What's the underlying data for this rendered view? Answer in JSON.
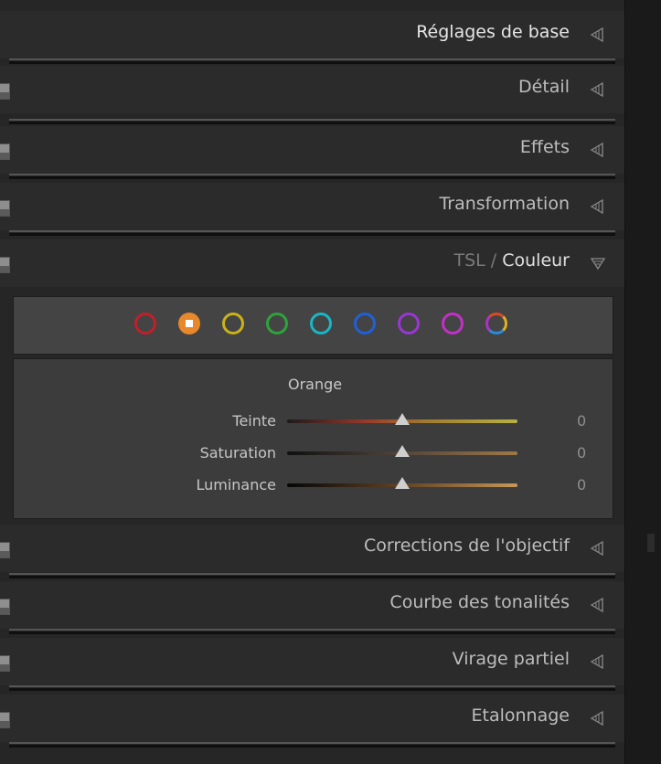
{
  "sections": {
    "basic": "Réglages de base",
    "detail": "Détail",
    "effects": "Effets",
    "transform": "Transformation",
    "hsl_prefix": "TSL",
    "hsl_slash": "/",
    "hsl_active": "Couleur",
    "lens": "Corrections de l'objectif",
    "tone_curve": "Courbe des tonalités",
    "split_toning": "Virage partiel",
    "calibration": "Etalonnage"
  },
  "color_swatches": [
    {
      "name": "red",
      "color": "#c0202a"
    },
    {
      "name": "orange",
      "color": "#e8882a",
      "selected": true
    },
    {
      "name": "yellow",
      "color": "#c9b21a"
    },
    {
      "name": "green",
      "color": "#2ea33a"
    },
    {
      "name": "aqua",
      "color": "#18b7c6"
    },
    {
      "name": "blue",
      "color": "#2060d8"
    },
    {
      "name": "purple",
      "color": "#9a35d8"
    },
    {
      "name": "magenta",
      "color": "#c330c8"
    },
    {
      "name": "all",
      "color": "multicolor"
    }
  ],
  "selected_color": "Orange",
  "sliders": {
    "hue": {
      "label": "Teinte",
      "value": "0",
      "position": 0.5
    },
    "saturation": {
      "label": "Saturation",
      "value": "0",
      "position": 0.5
    },
    "luminance": {
      "label": "Luminance",
      "value": "0",
      "position": 0.5
    }
  }
}
